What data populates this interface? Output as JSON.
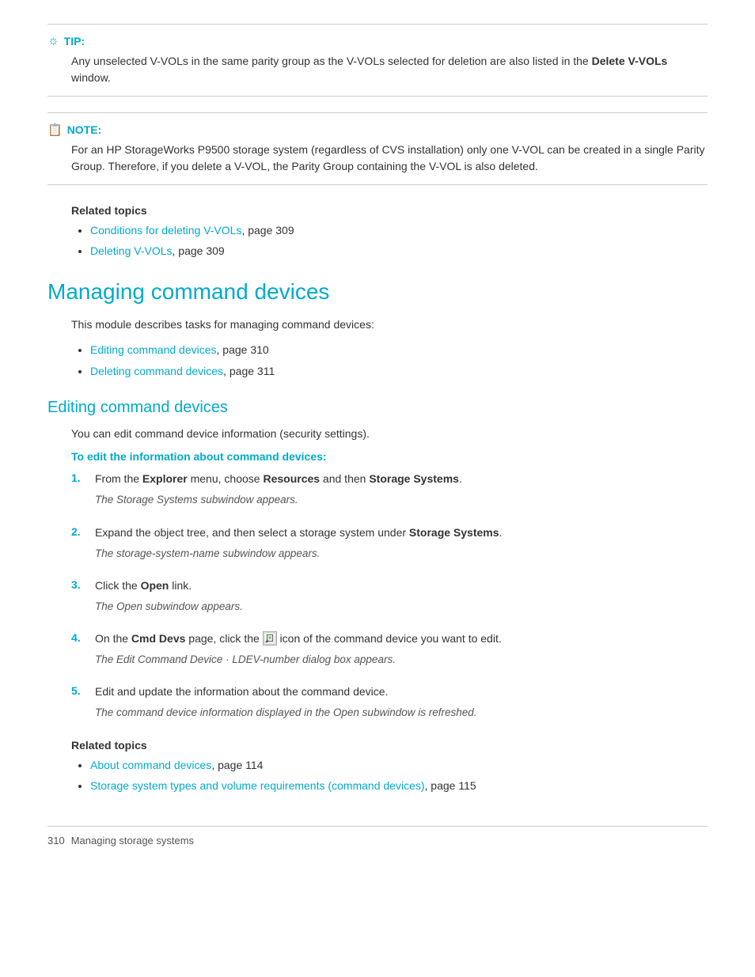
{
  "tip": {
    "label": "TIP:",
    "text": "Any unselected V-VOLs in the same parity group as the V-VOLs selected for deletion are also listed in the ",
    "bold_text": "Delete V-VOLs",
    "text2": " window."
  },
  "note": {
    "label": "NOTE:",
    "text": "For an HP StorageWorks P9500 storage system (regardless of CVS installation) only one V-VOL can be created in a single Parity Group. Therefore, if you delete a V-VOL, the Parity Group containing the V-VOL is also deleted."
  },
  "related_topics_1": {
    "label": "Related topics",
    "items": [
      {
        "link_text": "Conditions for deleting V-VOLs",
        "suffix": ", page 309"
      },
      {
        "link_text": "Deleting V-VOLs",
        "suffix": ", page 309"
      }
    ]
  },
  "managing_section": {
    "title": "Managing command devices",
    "desc": "This module describes tasks for managing command devices:",
    "bullets": [
      {
        "link_text": "Editing command devices",
        "suffix": ", page 310"
      },
      {
        "link_text": "Deleting command devices",
        "suffix": ", page 311"
      }
    ]
  },
  "editing_section": {
    "title": "Editing command devices",
    "desc": "You can edit command device information (security settings).",
    "procedure_intro": "To edit the information about command devices:",
    "steps": [
      {
        "num": "1.",
        "text": "From the ",
        "bold1": "Explorer",
        "mid1": " menu, choose ",
        "bold2": "Resources",
        "mid2": " and then ",
        "bold3": "Storage Systems",
        "end": ".",
        "sub": "The Storage Systems subwindow appears."
      },
      {
        "num": "2.",
        "text": "Expand the object tree, and then select a storage system under ",
        "bold1": "Storage Systems",
        "end": ".",
        "sub": "The storage-system-name subwindow appears.",
        "sub_italic": "storage-system-name"
      },
      {
        "num": "3.",
        "text": "Click the ",
        "bold1": "Open",
        "end": " link.",
        "sub": "The Open subwindow appears."
      },
      {
        "num": "4.",
        "text_pre": "On the ",
        "bold1": "Cmd Devs",
        "text_mid": " page, click the ",
        "icon": true,
        "text_after": " icon of the command device you want to edit.",
        "sub": "The Edit Command Device ·  LDEV-number  dialog box appears.",
        "sub_italic": "LDEV-number"
      },
      {
        "num": "5.",
        "text": "Edit and update the information about the command device.",
        "sub": "The command device information displayed in the Open subwindow is refreshed."
      }
    ]
  },
  "related_topics_2": {
    "label": "Related topics",
    "items": [
      {
        "link_text": "About command devices",
        "suffix": ", page 114"
      },
      {
        "link_text": "Storage system types and volume requirements (command devices)",
        "suffix": ", page 115"
      }
    ]
  },
  "footer": {
    "page_num": "310",
    "text": "Managing storage systems"
  }
}
